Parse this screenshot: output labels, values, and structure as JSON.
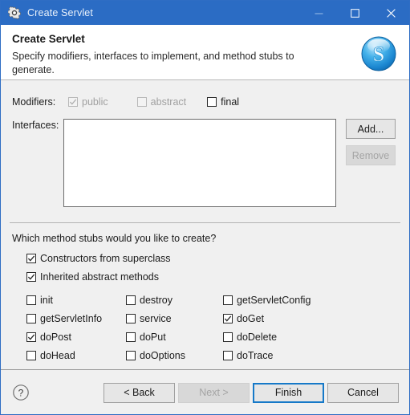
{
  "window": {
    "title": "Create Servlet",
    "icon": "gear-icon",
    "minimize_label": "–",
    "maximize_label": "□",
    "close_label": "✕",
    "accent_color": "#2b6cc4"
  },
  "header": {
    "title": "Create Servlet",
    "description": "Specify modifiers, interfaces to implement, and method stubs to generate.",
    "logo": "servlet-s-logo"
  },
  "modifiers": {
    "label": "Modifiers:",
    "items": [
      {
        "label": "public",
        "checked": true,
        "enabled": false
      },
      {
        "label": "abstract",
        "checked": false,
        "enabled": false
      },
      {
        "label": "final",
        "checked": false,
        "enabled": true
      }
    ]
  },
  "interfaces": {
    "label": "Interfaces:",
    "items": [],
    "add_label": "Add...",
    "remove_label": "Remove",
    "add_enabled": true,
    "remove_enabled": false
  },
  "method_stubs": {
    "question": "Which method stubs would you like to create?",
    "main": [
      {
        "label": "Constructors from superclass",
        "checked": true
      },
      {
        "label": "Inherited abstract methods",
        "checked": true
      }
    ],
    "grid": [
      {
        "label": "init",
        "checked": false
      },
      {
        "label": "destroy",
        "checked": false
      },
      {
        "label": "getServletConfig",
        "checked": false
      },
      {
        "label": "getServletInfo",
        "checked": false
      },
      {
        "label": "service",
        "checked": false
      },
      {
        "label": "doGet",
        "checked": true
      },
      {
        "label": "doPost",
        "checked": true
      },
      {
        "label": "doPut",
        "checked": false
      },
      {
        "label": "doDelete",
        "checked": false
      },
      {
        "label": "doHead",
        "checked": false
      },
      {
        "label": "doOptions",
        "checked": false
      },
      {
        "label": "doTrace",
        "checked": false
      }
    ]
  },
  "footer": {
    "help_label": "?",
    "buttons": [
      {
        "label": "< Back",
        "enabled": true,
        "primary": false
      },
      {
        "label": "Next >",
        "enabled": false,
        "primary": false
      },
      {
        "label": "Finish",
        "enabled": true,
        "primary": true
      },
      {
        "label": "Cancel",
        "enabled": true,
        "primary": false
      }
    ]
  }
}
